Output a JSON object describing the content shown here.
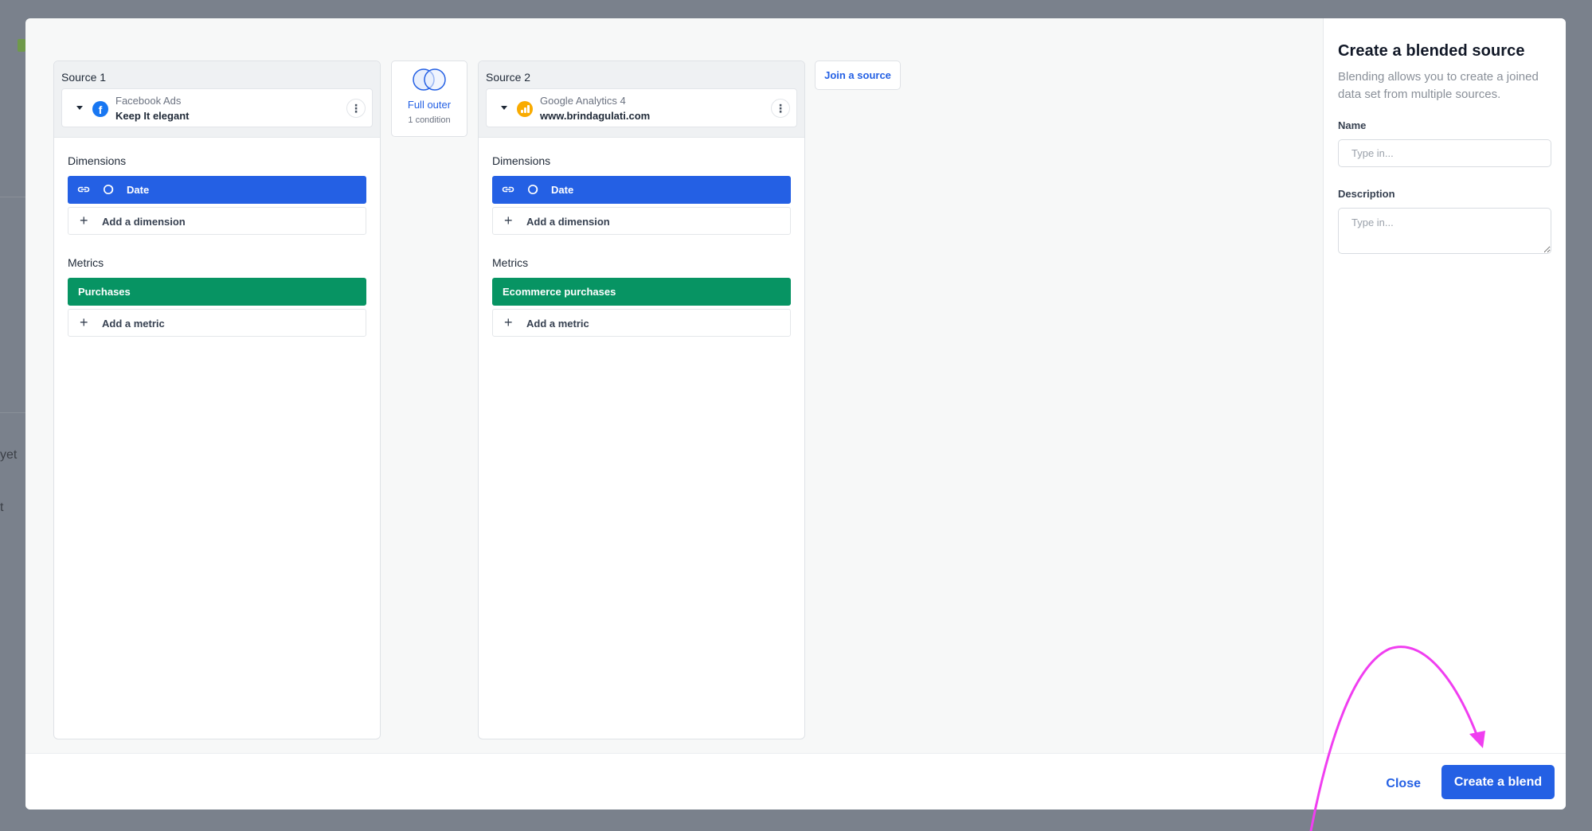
{
  "background": {
    "fragment_1": "yet",
    "fragment_2": "t"
  },
  "sources": [
    {
      "title": "Source 1",
      "type": "Facebook Ads",
      "name": "Keep It elegant",
      "logo": "facebook-logo",
      "dimensions_label": "Dimensions",
      "dimensions": [
        "Date"
      ],
      "add_dimension": "Add a dimension",
      "metrics_label": "Metrics",
      "metrics": [
        "Purchases"
      ],
      "add_metric": "Add a metric"
    },
    {
      "title": "Source 2",
      "type": "Google Analytics 4",
      "name": "www.brindagulati.com",
      "logo": "google-analytics-logo",
      "dimensions_label": "Dimensions",
      "dimensions": [
        "Date"
      ],
      "add_dimension": "Add a dimension",
      "metrics_label": "Metrics",
      "metrics": [
        "Ecommerce purchases"
      ],
      "add_metric": "Add a metric"
    }
  ],
  "join": {
    "type": "Full outer",
    "conditions": "1 condition",
    "icon": "venn-diagram-icon"
  },
  "join_source_button": "Join a source",
  "sidebar": {
    "title": "Create a blended source",
    "description": "Blending allows you to create a joined data set from multiple sources.",
    "name_label": "Name",
    "name_placeholder": "Type in...",
    "description_label": "Description",
    "description_placeholder": "Type in..."
  },
  "footer": {
    "close_label": "Close",
    "create_label": "Create a blend"
  },
  "colors": {
    "primary": "#2460e4",
    "metric_green": "#079463",
    "annotation_arrow": "#f03ef0"
  }
}
